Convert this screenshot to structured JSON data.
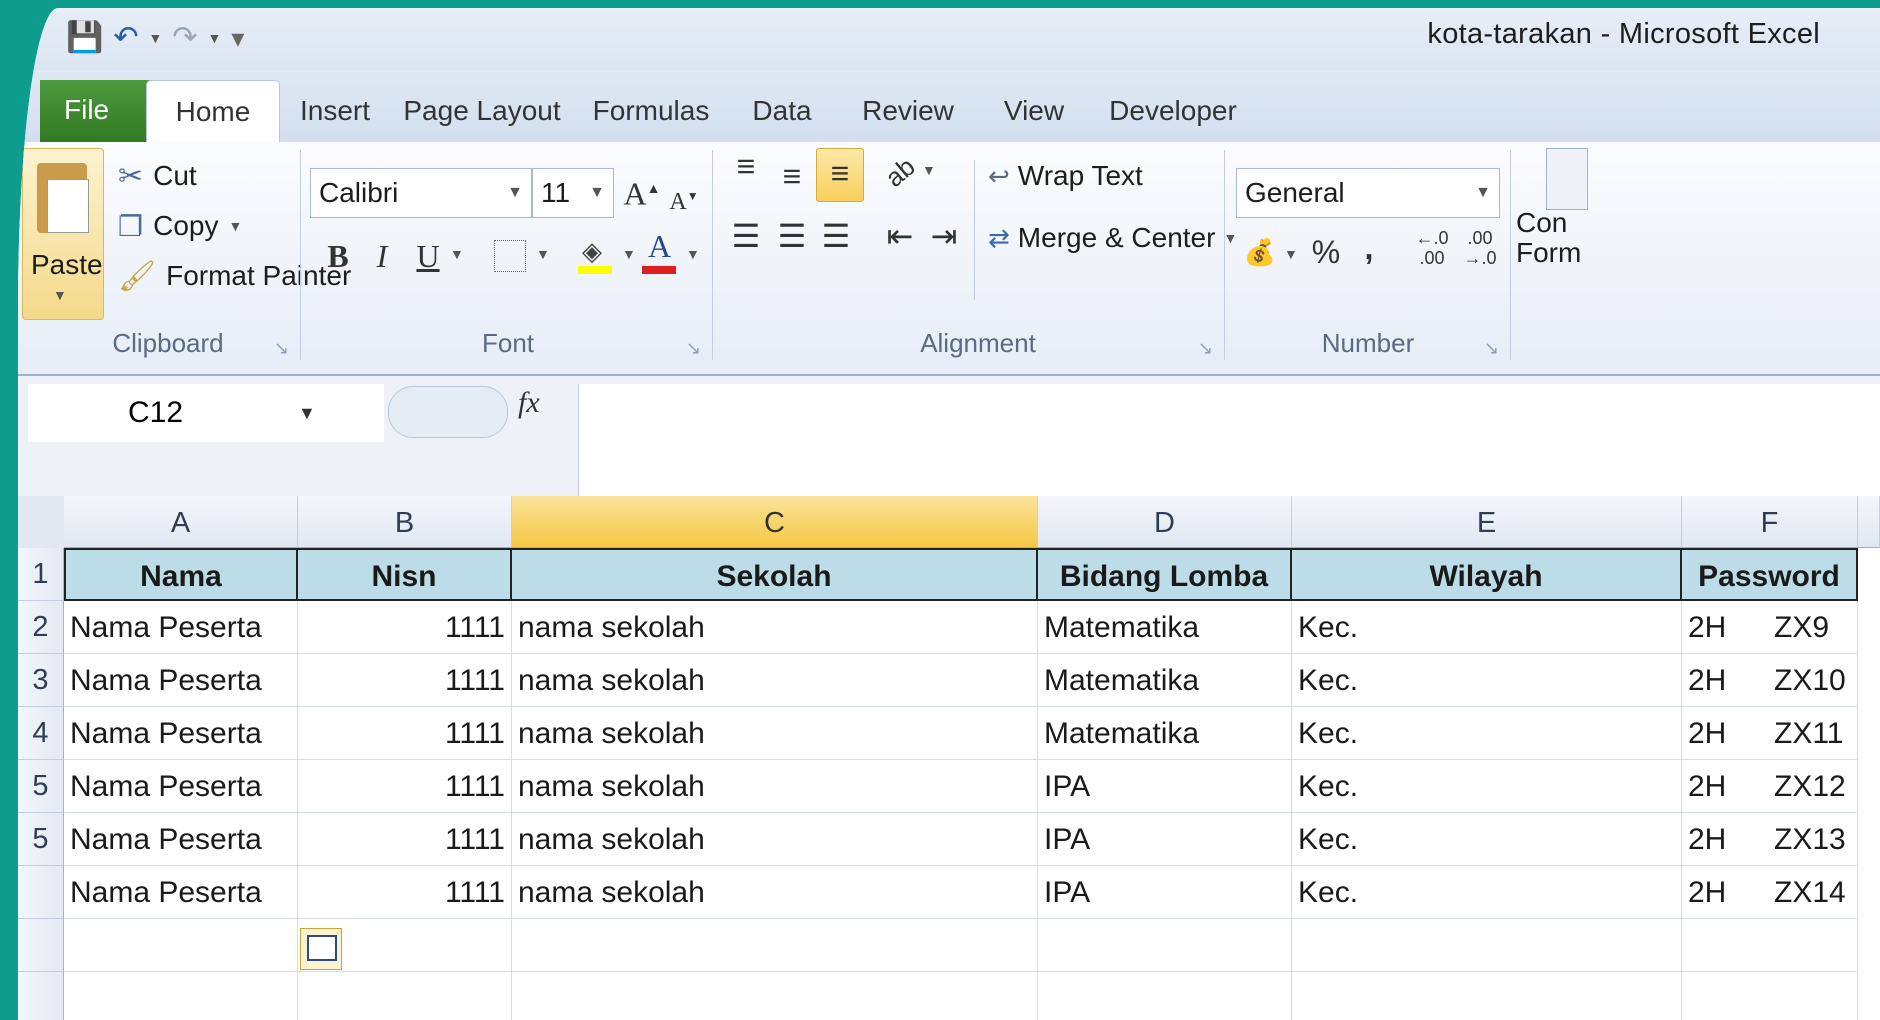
{
  "window": {
    "title": "kota-tarakan  -  Microsoft Excel"
  },
  "tabs": [
    {
      "label": "File"
    },
    {
      "label": "Home"
    },
    {
      "label": "Insert"
    },
    {
      "label": "Page Layout"
    },
    {
      "label": "Formulas"
    },
    {
      "label": "Data"
    },
    {
      "label": "Review"
    },
    {
      "label": "View"
    },
    {
      "label": "Developer"
    }
  ],
  "clipboard": {
    "paste": "Paste",
    "cut": "Cut",
    "copy": "Copy",
    "format_painter": "Format Painter",
    "group": "Clipboard"
  },
  "font": {
    "name": "Calibri",
    "size": "11",
    "group": "Font",
    "bold": "B",
    "italic": "I",
    "underline": "U"
  },
  "alignment": {
    "wrap": "Wrap Text",
    "merge": "Merge & Center",
    "group": "Alignment"
  },
  "number": {
    "format": "General",
    "group": "Number",
    "percent": "%",
    "comma": ","
  },
  "styles": {
    "partial": "Con\nForm"
  },
  "formula_bar": {
    "name_box": "C12",
    "fx": "fx",
    "content": ""
  },
  "sheet": {
    "columns": [
      "A",
      "B",
      "C",
      "D",
      "E",
      "F"
    ],
    "selected_column": "C",
    "header": [
      "Nama",
      "Nisn",
      "Sekolah",
      "Bidang Lomba",
      "Wilayah",
      "Password"
    ],
    "rows": [
      {
        "num": "1"
      },
      {
        "num": "2",
        "a": "Nama Peserta",
        "b": "1111",
        "c": "nama sekolah",
        "d": "Matematika",
        "e": "Kec.",
        "f1": "2H",
        "f2": "ZX9"
      },
      {
        "num": "3",
        "a": "Nama Peserta",
        "b": "1111",
        "c": "nama sekolah",
        "d": "Matematika",
        "e": "Kec.",
        "f1": "2H",
        "f2": "ZX10"
      },
      {
        "num": "4",
        "a": "Nama Peserta",
        "b": "1111",
        "c": "nama sekolah",
        "d": "Matematika",
        "e": "Kec.",
        "f1": "2H",
        "f2": "ZX11"
      },
      {
        "num": "5",
        "a": "Nama Peserta",
        "b": "1111",
        "c": "nama sekolah",
        "d": "IPA",
        "e": "Kec.",
        "f1": "2H",
        "f2": "ZX12"
      },
      {
        "num": "5",
        "a": "Nama Peserta",
        "b": "1111",
        "c": "nama sekolah",
        "d": "IPA",
        "e": "Kec.",
        "f1": "2H",
        "f2": "ZX13"
      },
      {
        "num": "",
        "a": "Nama Peserta",
        "b": "1111",
        "c": "nama sekolah",
        "d": "IPA",
        "e": "Kec.",
        "f1": "2H",
        "f2": "ZX14"
      }
    ]
  }
}
